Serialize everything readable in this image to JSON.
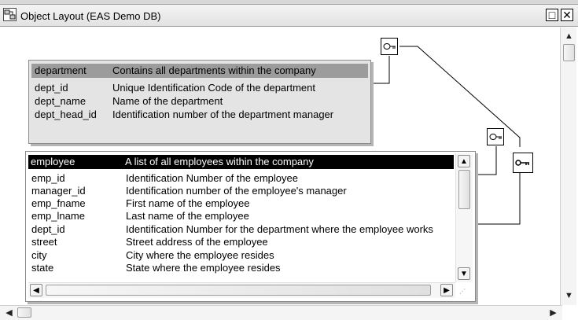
{
  "window": {
    "title": "Object Layout (EAS Demo DB)",
    "restore_glyph": "□",
    "close_glyph": "✕"
  },
  "icons": {
    "window_icon": "layout-icon",
    "key": "key-icon",
    "scroll_up": "▲",
    "scroll_down": "▼",
    "scroll_left": "◀",
    "scroll_right": "▶",
    "grip": "⋰"
  },
  "department": {
    "header_name": "department",
    "header_desc": "Contains all departments within the company",
    "columns": [
      {
        "name": "dept_id",
        "desc": "Unique Identification Code of the department"
      },
      {
        "name": "dept_name",
        "desc": "Name of the department"
      },
      {
        "name": "dept_head_id",
        "desc": "Identification number of the department manager"
      }
    ]
  },
  "employee": {
    "header_name": "employee",
    "header_desc": "A list of all employees within the company",
    "columns": [
      {
        "name": "emp_id",
        "desc": "Identification Number of the employee"
      },
      {
        "name": "manager_id",
        "desc": "Identification number of the employee's manager"
      },
      {
        "name": "emp_fname",
        "desc": "First name of the employee"
      },
      {
        "name": "emp_lname",
        "desc": "Last name of the employee"
      },
      {
        "name": "dept_id",
        "desc": "Identification Number for the department where the employee works"
      },
      {
        "name": "street",
        "desc": "Street address of the employee"
      },
      {
        "name": "city",
        "desc": "City where the employee resides"
      },
      {
        "name": "state",
        "desc": "State where the employee resides"
      }
    ]
  },
  "colors": {
    "dept_header": "#9c9c9c",
    "dept_body": "#e4e4e4",
    "emp_header": "#000000",
    "connector": "#000000"
  }
}
